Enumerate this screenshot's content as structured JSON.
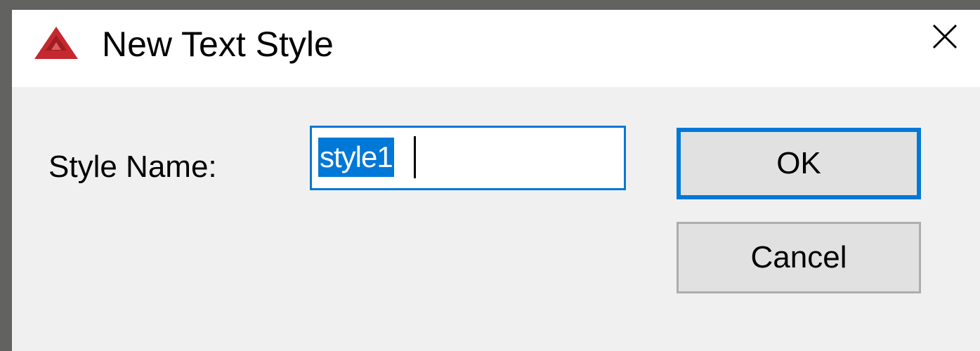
{
  "window": {
    "title": "New Text Style",
    "app_icon": "autocad-a-icon",
    "close_icon": "close-x-icon"
  },
  "form": {
    "label": "Style Name:",
    "input_value": "style1"
  },
  "buttons": {
    "ok_label": "OK",
    "cancel_label": "Cancel"
  },
  "colors": {
    "accent": "#0078d7",
    "icon_red": "#c5282e",
    "dialog_bg": "#f0f0f0",
    "outer_bg": "#626260"
  }
}
